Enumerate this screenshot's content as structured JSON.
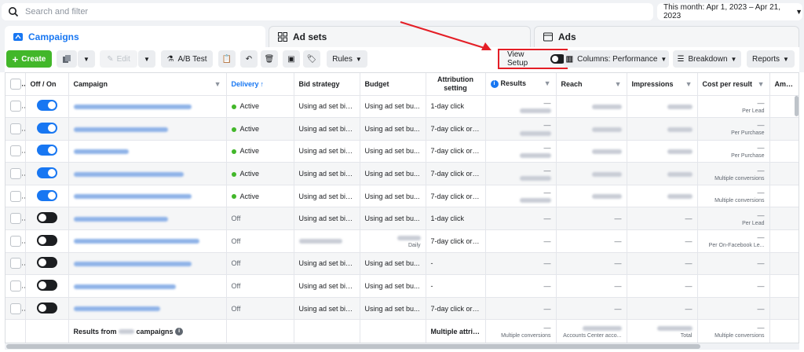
{
  "search": {
    "placeholder": "Search and filter"
  },
  "date_range": "This month: Apr 1, 2023 – Apr 21, 2023",
  "tabs": [
    {
      "label": "Campaigns",
      "icon": "campaigns-icon"
    },
    {
      "label": "Ad sets",
      "icon": "adsets-icon"
    },
    {
      "label": "Ads",
      "icon": "ads-icon"
    }
  ],
  "toolbar": {
    "create": "Create",
    "edit": "Edit",
    "ab_test": "A/B Test",
    "rules": "Rules",
    "view_setup": "View Setup",
    "columns": "Columns: Performance",
    "breakdown": "Breakdown",
    "reports": "Reports"
  },
  "colors": {
    "accent": "#1877f2",
    "create": "#42b72a",
    "highlight": "#e41e26"
  },
  "table": {
    "headers": {
      "off_on": "Off / On",
      "campaign": "Campaign",
      "delivery": "Delivery",
      "bid_strategy": "Bid strategy",
      "budget": "Budget",
      "attribution": "Attribution setting",
      "results": "Results",
      "reach": "Reach",
      "impressions": "Impressions",
      "cost_per_result": "Cost per result",
      "amount": "Amount"
    },
    "rows": [
      {
        "on": true,
        "delivery": "Active",
        "bid": "Using ad set bid...",
        "budget": "Using ad set bu...",
        "attribution": "1-day click",
        "results": "—",
        "cost": "—",
        "cost_sub": "Per Lead"
      },
      {
        "on": true,
        "delivery": "Active",
        "bid": "Using ad set bid...",
        "budget": "Using ad set bu...",
        "attribution": "7-day click or ...",
        "results": "—",
        "cost": "—",
        "cost_sub": "Per Purchase"
      },
      {
        "on": true,
        "delivery": "Active",
        "bid": "Using ad set bid...",
        "budget": "Using ad set bu...",
        "attribution": "7-day click or ...",
        "results": "—",
        "cost": "—",
        "cost_sub": "Per Purchase"
      },
      {
        "on": true,
        "delivery": "Active",
        "bid": "Using ad set bid...",
        "budget": "Using ad set bu...",
        "attribution": "7-day click or ...",
        "results": "—",
        "cost": "—",
        "cost_sub": "Multiple conversions"
      },
      {
        "on": true,
        "delivery": "Active",
        "bid": "Using ad set bid...",
        "budget": "Using ad set bu...",
        "attribution": "7-day click or ...",
        "results": "—",
        "cost": "—",
        "cost_sub": "Multiple conversions"
      },
      {
        "on": false,
        "delivery": "Off",
        "bid": "Using ad set bid...",
        "budget": "Using ad set bu...",
        "attribution": "1-day click",
        "results": "—",
        "cost": "—",
        "cost_sub": "Per Lead"
      },
      {
        "on": false,
        "delivery": "Off",
        "bid": "",
        "budget": "Daily",
        "attribution": "7-day click or ...",
        "results": "—",
        "cost": "—",
        "cost_sub": "Per On-Facebook Le..."
      },
      {
        "on": false,
        "delivery": "Off",
        "bid": "Using ad set bid...",
        "budget": "Using ad set bu...",
        "attribution": "-",
        "results": "—",
        "cost": "—",
        "cost_sub": ""
      },
      {
        "on": false,
        "delivery": "Off",
        "bid": "Using ad set bid...",
        "budget": "Using ad set bu...",
        "attribution": "-",
        "results": "—",
        "cost": "—",
        "cost_sub": ""
      },
      {
        "on": false,
        "delivery": "Off",
        "bid": "Using ad set bid...",
        "budget": "Using ad set bu...",
        "attribution": "7-day click or ...",
        "results": "—",
        "cost": "—",
        "cost_sub": ""
      }
    ],
    "footer": {
      "results_from": "Results from",
      "campaigns": "campaigns",
      "attribution": "Multiple attrib...",
      "results": "—",
      "results_sub": "Multiple conversions",
      "reach_sub": "Accounts Center acco...",
      "impressions_sub": "Total",
      "cost": "—",
      "cost_sub": "Multiple conversions"
    }
  }
}
